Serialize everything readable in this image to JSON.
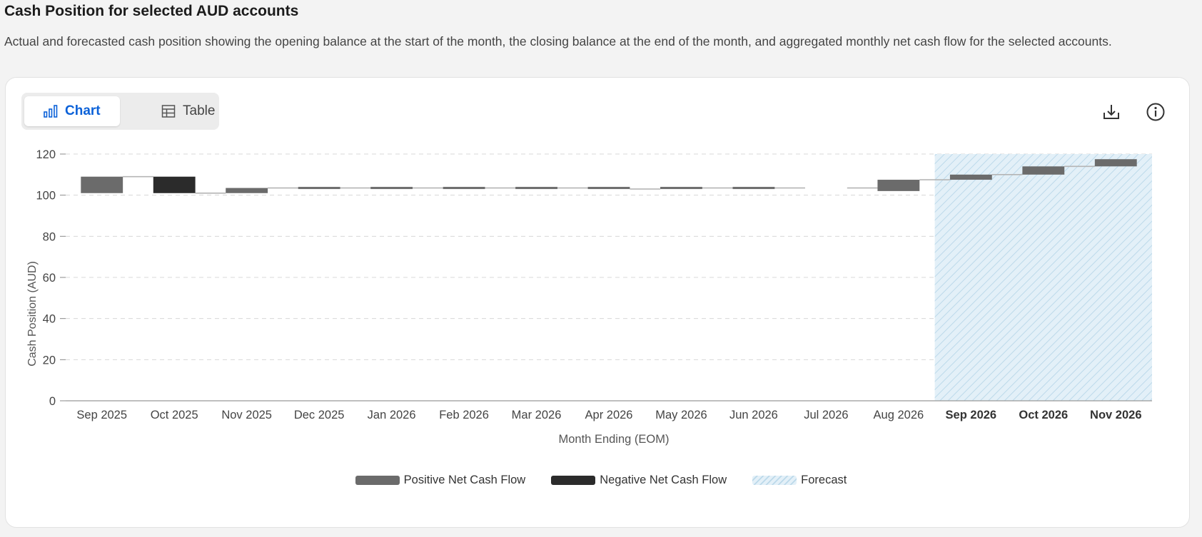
{
  "header": {
    "title": "Cash Position for selected AUD accounts",
    "description": "Actual and forecasted cash position showing the opening balance at the start of the month, the closing balance at the end of the month, and aggregated monthly net cash flow for the selected accounts."
  },
  "view_toggle": {
    "chart_label": "Chart",
    "table_label": "Table",
    "selected": "Chart"
  },
  "actions": {
    "download_icon": "download-icon",
    "info_icon": "info-icon"
  },
  "colors": {
    "positive": "#6b6b6b",
    "negative": "#2b2b2b",
    "forecast_fill": "#e3f0f8",
    "forecast_hatch": "#bcd9ea",
    "connector": "#b5b5b5",
    "grid": "#d8d8d8",
    "active_tab": "#0b61d8"
  },
  "chart_data": {
    "type": "bar",
    "chart_subtype": "waterfall",
    "xlabel": "Month Ending (EOM)",
    "ylabel": "Cash Position (AUD)",
    "ylim": [
      0,
      120
    ],
    "yticks": [
      0,
      20,
      40,
      60,
      80,
      100,
      120
    ],
    "grid": true,
    "legend_placement": "bottom-center",
    "categories": [
      "Sep 2025",
      "Oct 2025",
      "Nov 2025",
      "Dec 2025",
      "Jan 2026",
      "Feb 2026",
      "Mar 2026",
      "Apr 2026",
      "May 2026",
      "Jun 2026",
      "Jul 2026",
      "Aug 2026",
      "Sep 2026",
      "Oct 2026",
      "Nov 2026"
    ],
    "forecast_categories": [
      "Sep 2026",
      "Oct 2026",
      "Nov 2026"
    ],
    "opening": [
      101,
      109,
      101,
      103.5,
      103.5,
      103.5,
      103.5,
      103.5,
      103,
      103.5,
      103.5,
      102,
      107.5,
      110,
      114
    ],
    "closing": [
      109,
      101,
      103.5,
      103.5,
      103.5,
      103.5,
      103.5,
      103,
      103.5,
      103.5,
      103.5,
      107.5,
      110,
      114,
      117.5
    ],
    "legend": [
      {
        "label": "Positive Net Cash Flow",
        "swatch": "positive"
      },
      {
        "label": "Negative Net Cash Flow",
        "swatch": "negative"
      },
      {
        "label": "Forecast",
        "swatch": "forecast"
      }
    ]
  }
}
